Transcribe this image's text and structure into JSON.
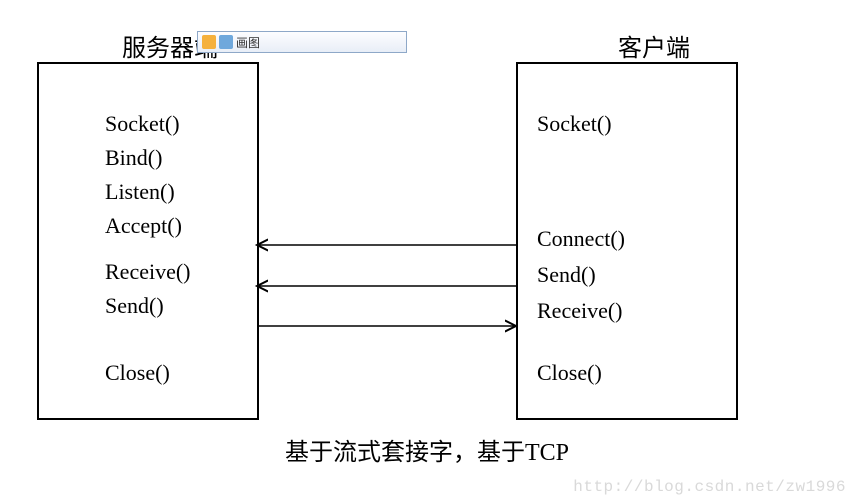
{
  "server": {
    "title": "服务器端",
    "items": [
      "Socket()",
      "Bind()",
      "Listen()",
      "Accept()",
      "Receive()",
      "Send()",
      "Close()"
    ]
  },
  "client": {
    "title": "客户端",
    "items": [
      "Socket()",
      "Connect()",
      "Send()",
      "Receive()",
      "Close()"
    ]
  },
  "caption": "基于流式套接字，基于TCP",
  "toolbar": {
    "label": "画图"
  },
  "watermark": "http://blog.csdn.net/zw1996",
  "chart_data": {
    "type": "diagram",
    "title": "基于流式套接字，基于TCP",
    "nodes": [
      {
        "id": "server",
        "label": "服务器端",
        "steps": [
          "Socket()",
          "Bind()",
          "Listen()",
          "Accept()",
          "Receive()",
          "Send()",
          "Close()"
        ]
      },
      {
        "id": "client",
        "label": "客户端",
        "steps": [
          "Socket()",
          "Connect()",
          "Send()",
          "Receive()",
          "Close()"
        ]
      }
    ],
    "edges": [
      {
        "from": "client.Connect()",
        "to": "server.Accept()",
        "direction": "right-to-left"
      },
      {
        "from": "client.Send()",
        "to": "server.Receive()",
        "direction": "right-to-left"
      },
      {
        "from": "server.Send()",
        "to": "client.Receive()",
        "direction": "left-to-right"
      }
    ]
  }
}
